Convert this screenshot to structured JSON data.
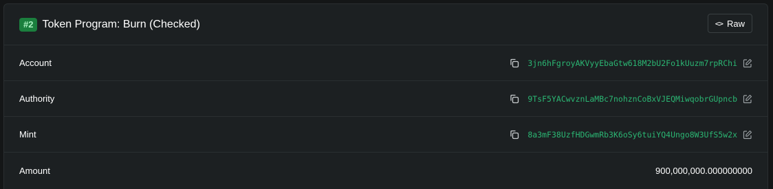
{
  "header": {
    "badge": "#2",
    "title": "Token Program: Burn (Checked)",
    "raw_button": {
      "icon": "code-icon",
      "icon_glyph": "<>",
      "label": "Raw"
    }
  },
  "rows": [
    {
      "label": "Account",
      "value": "3jn6hFgroyAKVyyEbaGtw618M2bU2Fo1kUuzm7rpRChi",
      "copy_icon": "copy-icon",
      "edit_icon": "edit-icon"
    },
    {
      "label": "Authority",
      "value": "9TsF5YACwvznLaMBc7nohznCoBxVJEQMiwqobrGUpncb",
      "copy_icon": "copy-icon",
      "edit_icon": "edit-icon"
    },
    {
      "label": "Mint",
      "value": "8a3mF38UzfHDGwmRb3K6oSy6tuiYQ4Ungo8W3UfS5w2x",
      "copy_icon": "copy-icon",
      "edit_icon": "edit-icon"
    },
    {
      "label": "Amount",
      "value": "900,000,000.000000000"
    }
  ],
  "colors": {
    "background": "#141617",
    "card": "#1c2022",
    "border": "#2a2f31",
    "badge_bg": "#1b7f3e",
    "badge_text": "#a8f0c0",
    "address": "#2bb673",
    "text": "#ffffff"
  }
}
